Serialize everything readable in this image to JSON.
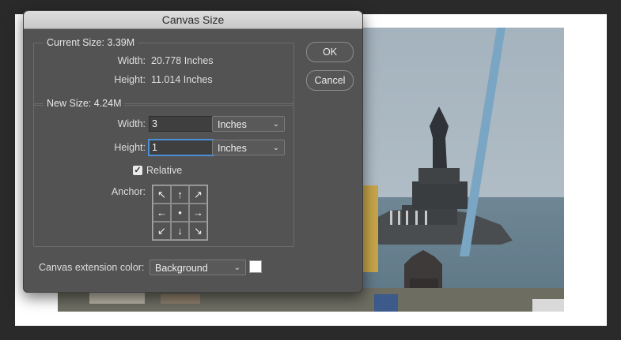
{
  "dialog": {
    "title": "Canvas Size",
    "current_size": {
      "legend": "Current Size: 3.39M",
      "width_label": "Width:",
      "width_value": "20.778 Inches",
      "height_label": "Height:",
      "height_value": "11.014 Inches"
    },
    "new_size": {
      "legend": "New Size: 4.24M",
      "width_label": "Width:",
      "width_value": "3",
      "width_unit": "Inches",
      "height_label": "Height:",
      "height_value": "1",
      "height_unit": "Inches",
      "relative_label": "Relative",
      "relative_checked": true,
      "anchor_label": "Anchor:",
      "anchor_icons": [
        "arrow-nw-icon",
        "arrow-n-icon",
        "arrow-ne-icon",
        "arrow-w-icon",
        "center-dot-icon",
        "arrow-e-icon",
        "arrow-sw-icon",
        "arrow-s-icon",
        "arrow-se-icon"
      ],
      "anchor_glyphs": [
        "↖",
        "↑",
        "↗",
        "←",
        "●",
        "→",
        "↙",
        "↓",
        "↘"
      ]
    },
    "extension": {
      "label": "Canvas extension color:",
      "value": "Background",
      "swatch_color": "#ffffff"
    },
    "buttons": {
      "ok": "OK",
      "cancel": "Cancel"
    }
  },
  "colors": {
    "dialog_bg": "#535353",
    "focus_ring": "#4d8fd6",
    "canvas": "#ffffff"
  }
}
